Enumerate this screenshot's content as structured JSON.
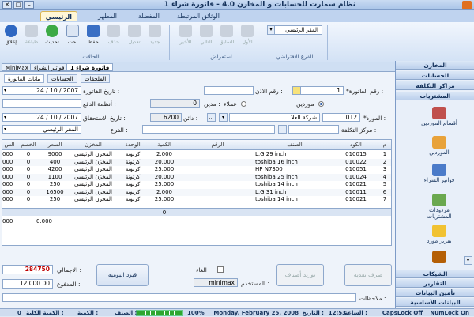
{
  "window": {
    "title": "نظام سمارت للحسابات و المخازن 4.0 - فاتورة شراء 1"
  },
  "tabs": [
    "الرئيسي",
    "المظهر",
    "المفضلة",
    "الوثائق المرتبطة"
  ],
  "ribbon": {
    "actions": {
      "close": "إغلاق",
      "print": "طباعة",
      "refresh": "تحديث",
      "search": "بحث",
      "save": "حفظ",
      "delete": "حذف",
      "edit": "تعديل",
      "new": "جديد"
    },
    "actions_group": "الحالات",
    "browse": {
      "last": "الأخير",
      "next": "التالي",
      "prev": "السابق",
      "first": "الأول"
    },
    "browse_group": "استعراض",
    "branch_group": "الفرع الافتراضي",
    "branch_value": "المقر الرئيسي"
  },
  "doc_tabs": [
    "MiniMax",
    "فواتير الشراء",
    "فاتورة شراء 1"
  ],
  "form_tabs": [
    "بيانات الفاتورة",
    "الحسابات",
    "الملحقات"
  ],
  "form": {
    "invoice_no_label": "*رقم الفاتورة :",
    "invoice_no": "1",
    "permit_no_label": "رقم الاذن :",
    "permit_no": "",
    "invoice_date_label": "تاريخ الفاتورة :",
    "invoice_date": "24 / 10 / 2007",
    "suppliers_label": "موردين",
    "customers_label": "عملاء",
    "debit_label": "مدين :",
    "debit_value": "0",
    "payment_label": "أنظمة الدفع :",
    "payment_value": "",
    "supplier_label": "*المورد :",
    "supplier_code": "012",
    "supplier_name": "شركة العلا",
    "credit_label": "دائن :",
    "credit_value": "6200",
    "due_date_label": "تاريخ الاستحقاق :",
    "due_date": "24 / 10 / 2007",
    "cost_center_label": "مركز التكلفة :",
    "branch_label": "الفرع :",
    "branch_value": "المقر الرئيسي"
  },
  "grid": {
    "columns": [
      "م",
      "الكود",
      "الصنف",
      "الرقم",
      "الكمية",
      "الوحدة",
      "المخزن",
      "السعر",
      "الخصم",
      "الس"
    ],
    "rows": [
      [
        "1",
        "010015",
        "L.G 29 inch",
        "",
        "2.000",
        "كرتونة",
        "المخزن الرئيسي",
        "9000",
        "0",
        "000"
      ],
      [
        "2",
        "010022",
        "toshiba 16 inch",
        "",
        "20.000",
        "كرتونة",
        "المخزن الرئيسي",
        "400",
        "0",
        "000"
      ],
      [
        "3",
        "010051",
        "HP N7300",
        "",
        "25.000",
        "كرتونة",
        "المخزن الرئيسي",
        "4200",
        "0",
        "000"
      ],
      [
        "4",
        "010024",
        "toshiba 25 inch",
        "",
        "20.000",
        "كرتونة",
        "المخزن الرئيسي",
        "1100",
        "0",
        "000"
      ],
      [
        "5",
        "010021",
        "toshiba 14 inch",
        "",
        "25.000",
        "كرتونة",
        "المخزن الرئيسي",
        "250",
        "0",
        "000"
      ],
      [
        "6",
        "010011",
        "L.G 31 inch",
        "",
        "2.000",
        "كرتونة",
        "المخزن الرئيسي",
        "16500",
        "0",
        "000"
      ],
      [
        "7",
        "010021",
        "toshiba 14 inch",
        "",
        "25.000",
        "كرتونة",
        "المخزن الرئيسي",
        "250",
        "0",
        "000"
      ]
    ],
    "total_qty": "0",
    "total_disc": "0.000",
    "total_last": "000"
  },
  "footer": {
    "total_label": "الاجمالي :",
    "total_value": "284750",
    "paid_label": "المدفوع :",
    "paid_value": "12,000.00",
    "daily_button": "قيود اليومية",
    "cancel_label": "الغاء",
    "user_label": "المستخدم :",
    "user_value": "minimax",
    "supply_button": "توريد أصناف",
    "cash_button": "صرف نقدية",
    "notes_label": "ملاحظات :"
  },
  "sidebar": {
    "headers_top": [
      "المخازن",
      "الحسابات",
      "مراكز التكلفة",
      "المشتريات"
    ],
    "items": [
      "أقسام الموردين",
      "الموردين",
      "فواتير الشراء",
      "مردودات المشتريات",
      "تقرير مورد"
    ],
    "headers_bottom": [
      "الشيكات",
      "التقارير",
      "تأمين البيانات",
      "البيانات الأساسية"
    ]
  },
  "status": {
    "numlock": "NumLock On",
    "capslock": "CapsLock Off",
    "time": "12:53",
    "time_label": "الساعة :",
    "date": "Monday, February 25, 2008",
    "date_label": "التاريخ :",
    "zoom": "100%",
    "item_label": "الصنف :",
    "qty_label": "الكمية :",
    "total_qty_label": "الكمية الكلية :",
    "total_qty_value": "0",
    "progress_fraction": 1.0
  }
}
